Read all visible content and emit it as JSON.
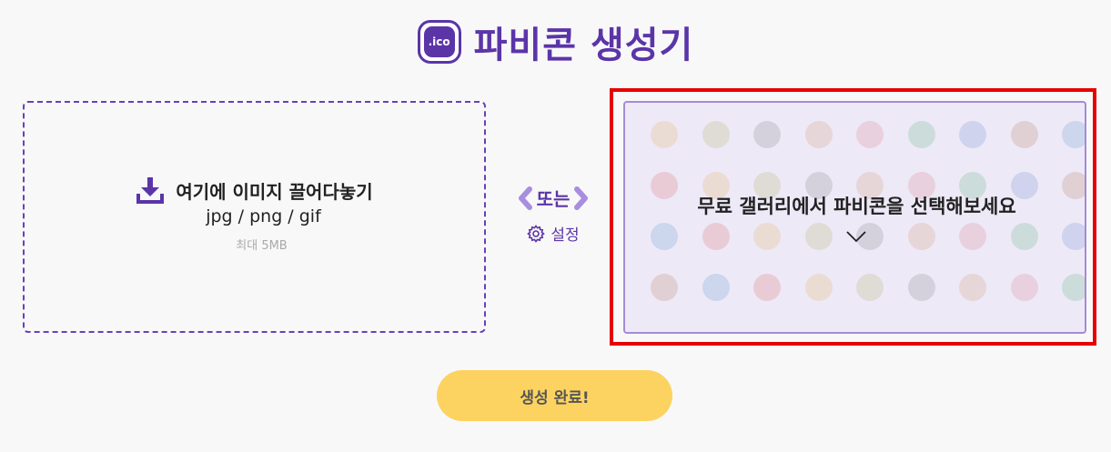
{
  "header": {
    "logo_text": ".ico",
    "title": "파비콘 생성기"
  },
  "dropzone": {
    "label": "여기에 이미지 끌어다놓기",
    "formats": "jpg / png / gif",
    "limit": "최대 5MB",
    "icon": "download-icon"
  },
  "separator": {
    "or_text": "또는",
    "settings_label": "설정",
    "left_icon": "chevron-left-icon",
    "right_icon": "chevron-right-icon",
    "settings_icon": "gear-icon"
  },
  "gallery": {
    "label": "무료 갤러리에서 파비콘을 선택해보세요",
    "icon": "chevron-down-icon"
  },
  "actions": {
    "submit_label": "생성 완료!"
  },
  "colors": {
    "brand": "#5b35a8",
    "button": "#fcd361",
    "highlight": "#e60000"
  }
}
